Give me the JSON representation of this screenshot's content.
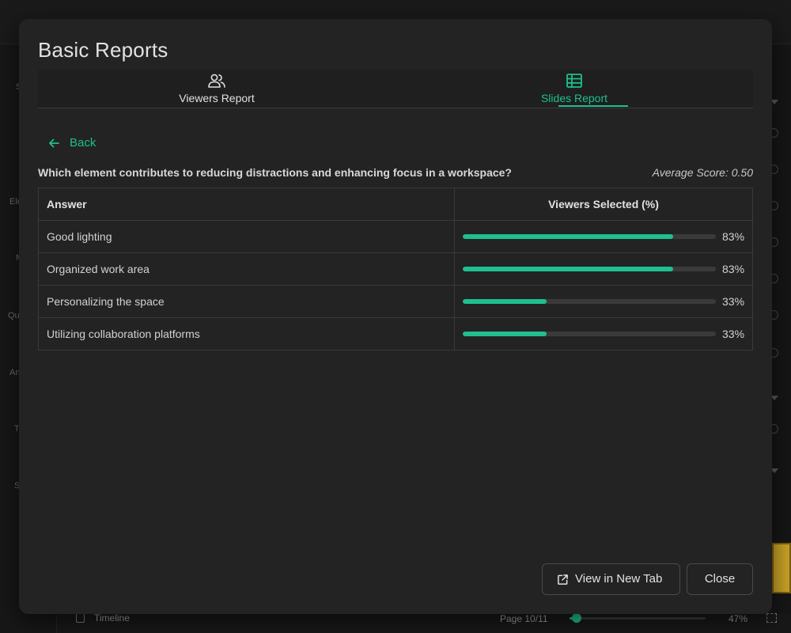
{
  "background": {
    "sidebar_labels": [
      "S",
      "Ele",
      "M",
      "Qu",
      "An",
      "T",
      "S"
    ],
    "timeline_label": "Timeline",
    "page_label": "Page 10/11",
    "zoom_label": "47%",
    "slider_value": 0.05
  },
  "modal": {
    "title": "Basic Reports",
    "tabs": [
      {
        "label": "Viewers Report",
        "icon": "users-icon",
        "active": false
      },
      {
        "label": "Slides Report",
        "icon": "table-icon",
        "active": true
      }
    ],
    "back_label": "Back",
    "question": "Which element contributes to reducing distractions and enhancing focus in a workspace?",
    "average_score": "Average Score: 0.50",
    "table": {
      "headers": [
        "Answer",
        "Viewers Selected (%)"
      ],
      "rows": [
        {
          "answer": "Good lighting",
          "percent": 83,
          "percent_label": "83%"
        },
        {
          "answer": "Organized work area",
          "percent": 83,
          "percent_label": "83%"
        },
        {
          "answer": "Personalizing the space",
          "percent": 33,
          "percent_label": "33%"
        },
        {
          "answer": "Utilizing collaboration platforms",
          "percent": 33,
          "percent_label": "33%"
        }
      ]
    },
    "buttons": {
      "view_new_tab": "View in New Tab",
      "close": "Close"
    }
  },
  "colors": {
    "accent": "#1fbf8f",
    "modal_bg": "#232323",
    "border": "#3a3a3a"
  }
}
